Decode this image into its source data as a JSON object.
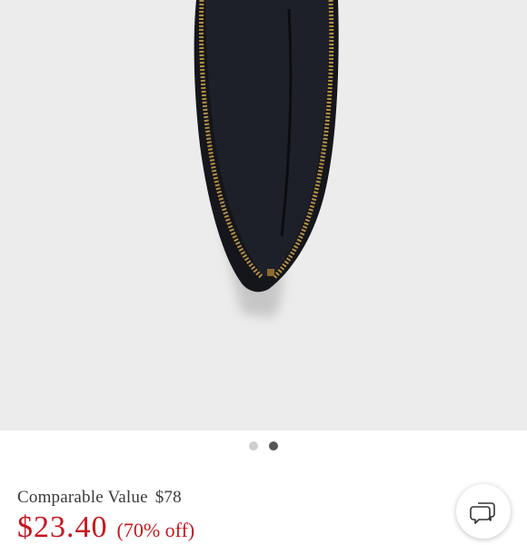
{
  "product": {
    "image_icon": "wristlet-pouch-image",
    "carousel": {
      "dot_count": 2,
      "active_index": 1
    }
  },
  "pricing": {
    "comparable_label": "Comparable Value",
    "comparable_value": "$78",
    "sale_price": "$23.40",
    "discount": "(70% off)",
    "price_color": "#c6171e"
  },
  "chat": {
    "icon": "chat-bubble-icon"
  }
}
